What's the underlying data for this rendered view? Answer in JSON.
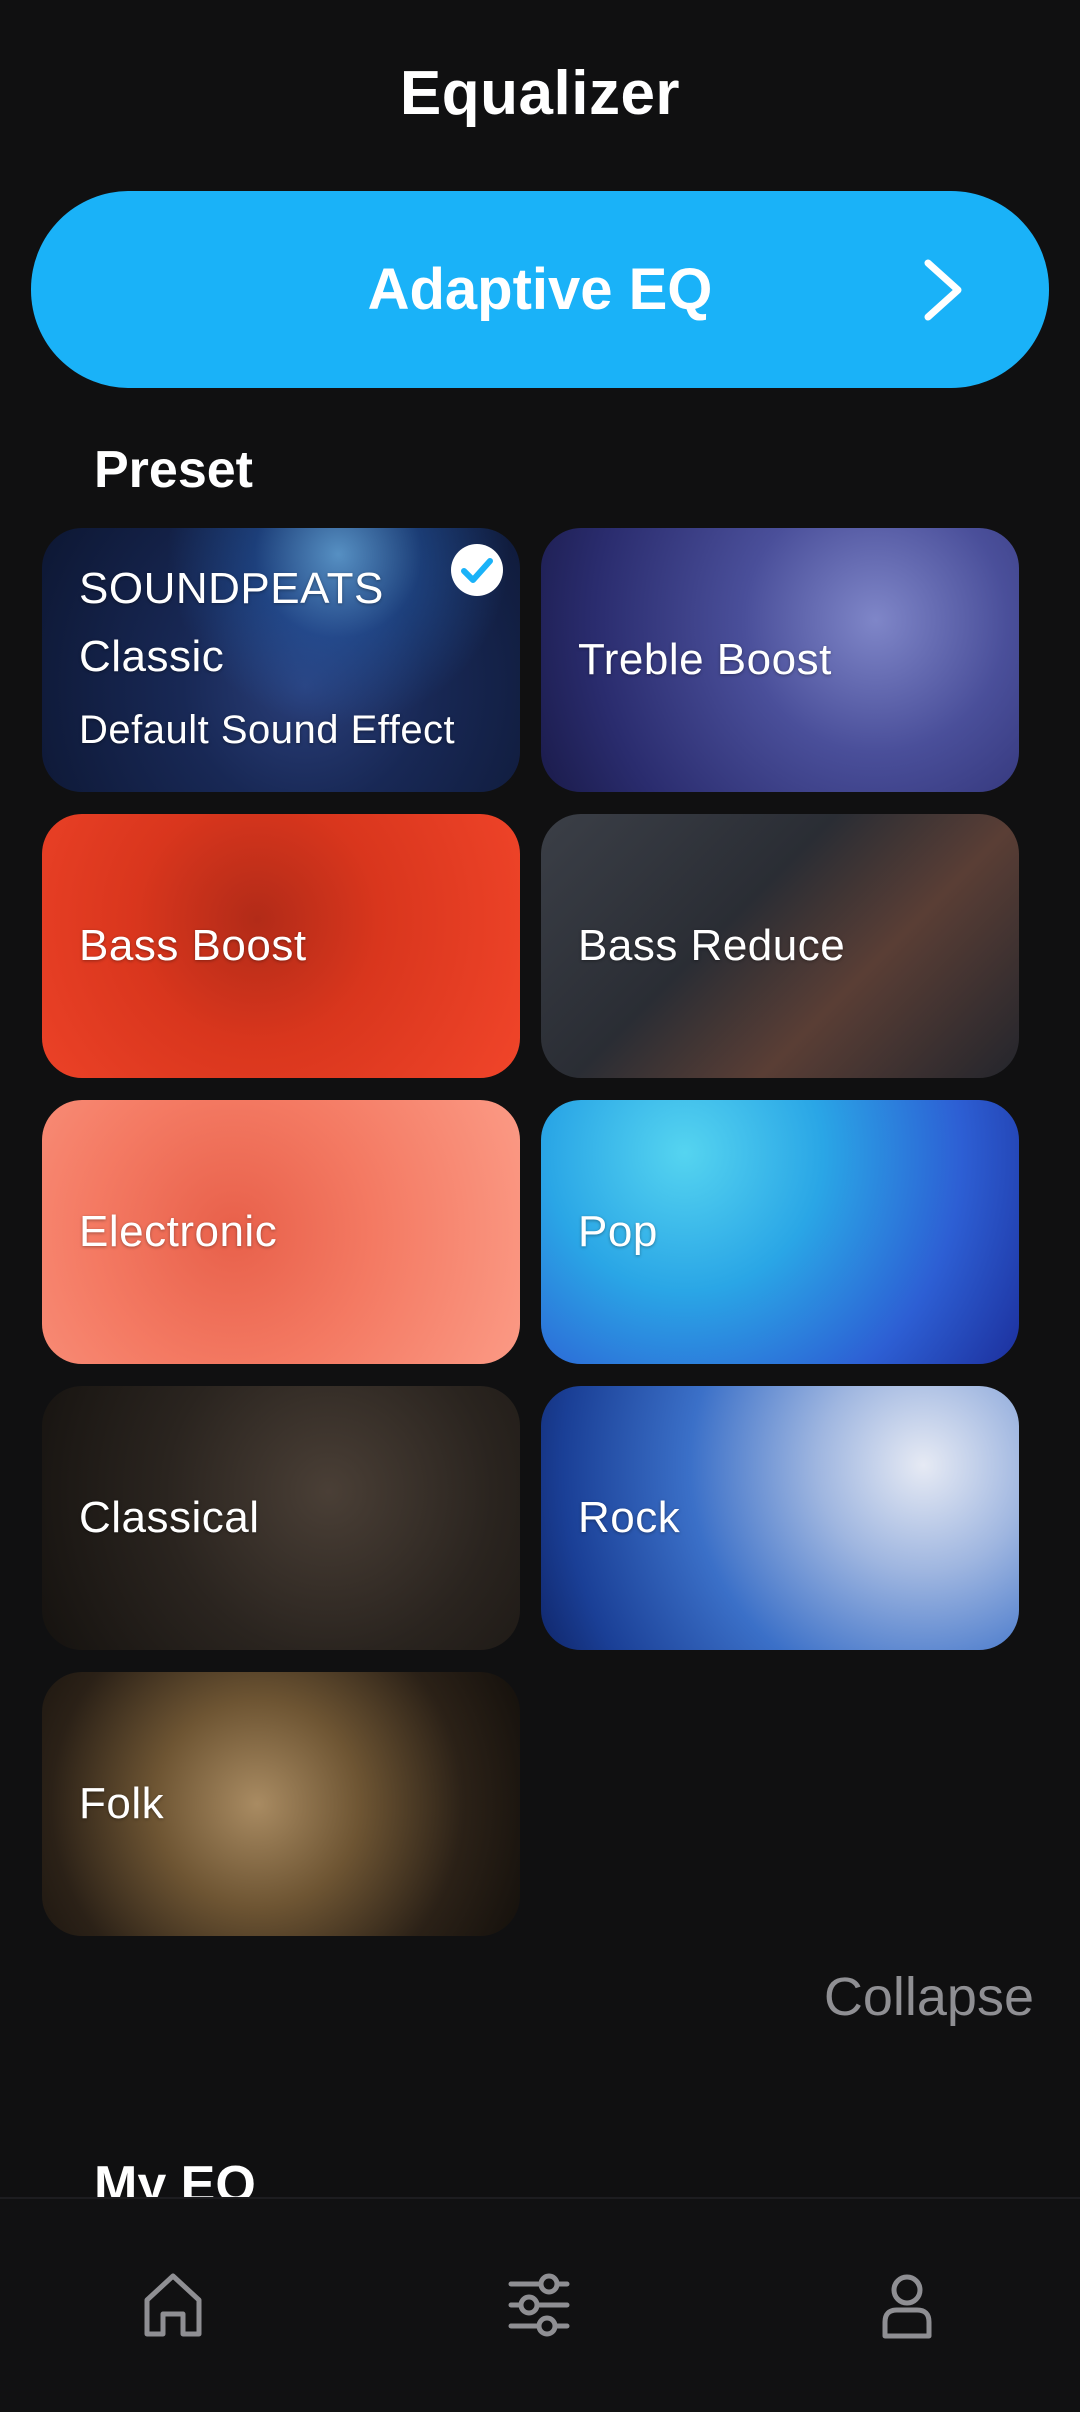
{
  "header": {
    "title": "Equalizer"
  },
  "adaptive": {
    "label": "Adaptive EQ",
    "icon": "chevron-right-icon",
    "color": "#1ab2f8"
  },
  "preset": {
    "title": "Preset",
    "items": [
      {
        "name": "SOUNDPEATS",
        "line2": "Classic",
        "subtitle": "Default Sound Effect",
        "selected": true
      },
      {
        "name": "Treble Boost"
      },
      {
        "name": "Bass Boost"
      },
      {
        "name": "Bass Reduce"
      },
      {
        "name": "Electronic"
      },
      {
        "name": "Pop"
      },
      {
        "name": "Classical"
      },
      {
        "name": "Rock"
      },
      {
        "name": "Folk"
      }
    ],
    "collapse_label": "Collapse"
  },
  "my_eq": {
    "title": "My EQ"
  },
  "tabbar": {
    "icons": [
      "home-icon",
      "sliders-icon",
      "person-icon"
    ]
  }
}
